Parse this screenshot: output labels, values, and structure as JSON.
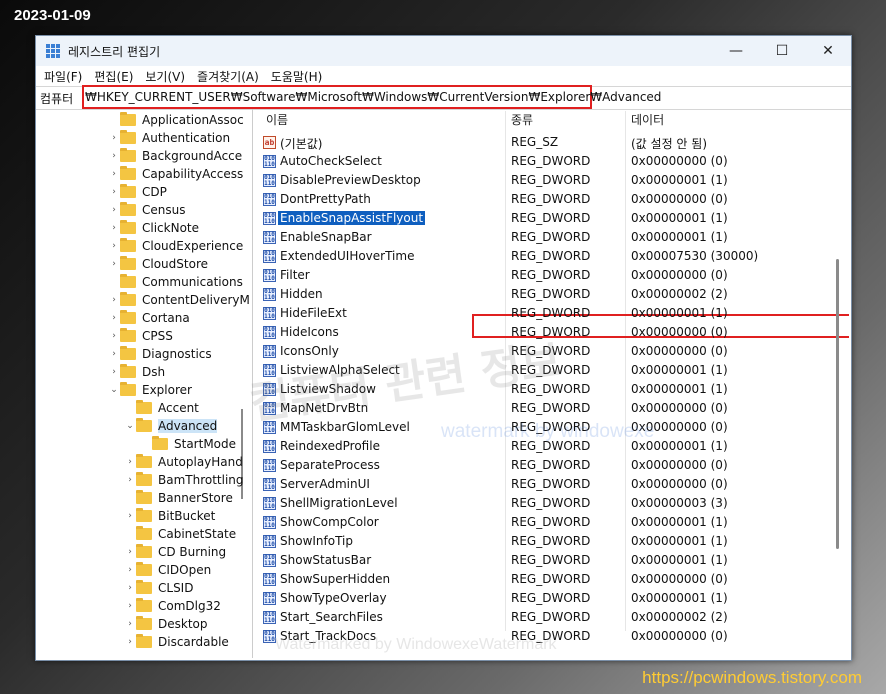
{
  "overlay": {
    "date": "2023-01-09",
    "blog_url": "https://pcwindows.tistory.com",
    "watermark_1": "컴퓨터 관련 정보",
    "watermark_2": "watermark by windowexe",
    "watermark_3": "Watermarked by WindowexeWatermark"
  },
  "window": {
    "title": "레지스트리 편집기",
    "minimize": "—",
    "maximize": "☐",
    "close": "✕"
  },
  "menu": [
    "파일(F)",
    "편집(E)",
    "보기(V)",
    "즐겨찾기(A)",
    "도움말(H)"
  ],
  "address": {
    "label": "컴퓨터",
    "path": "₩HKEY_CURRENT_USER₩Software₩Microsoft₩Windows₩CurrentVersion₩Explorer₩Advanced"
  },
  "tree": [
    {
      "label": "ApplicationAssoc",
      "level": 0,
      "chev": "",
      "selected": false
    },
    {
      "label": "Authentication",
      "level": 0,
      "chev": ">",
      "selected": false
    },
    {
      "label": "BackgroundAcce",
      "level": 0,
      "chev": ">",
      "selected": false
    },
    {
      "label": "CapabilityAccess",
      "level": 0,
      "chev": ">",
      "selected": false
    },
    {
      "label": "CDP",
      "level": 0,
      "chev": ">",
      "selected": false
    },
    {
      "label": "Census",
      "level": 0,
      "chev": ">",
      "selected": false
    },
    {
      "label": "ClickNote",
      "level": 0,
      "chev": ">",
      "selected": false
    },
    {
      "label": "CloudExperience",
      "level": 0,
      "chev": ">",
      "selected": false
    },
    {
      "label": "CloudStore",
      "level": 0,
      "chev": ">",
      "selected": false
    },
    {
      "label": "Communications",
      "level": 0,
      "chev": "",
      "selected": false
    },
    {
      "label": "ContentDeliveryM",
      "level": 0,
      "chev": ">",
      "selected": false
    },
    {
      "label": "Cortana",
      "level": 0,
      "chev": ">",
      "selected": false
    },
    {
      "label": "CPSS",
      "level": 0,
      "chev": ">",
      "selected": false
    },
    {
      "label": "Diagnostics",
      "level": 0,
      "chev": ">",
      "selected": false
    },
    {
      "label": "Dsh",
      "level": 0,
      "chev": ">",
      "selected": false
    },
    {
      "label": "Explorer",
      "level": 0,
      "chev": "v",
      "selected": false
    },
    {
      "label": "Accent",
      "level": 1,
      "chev": "",
      "selected": false
    },
    {
      "label": "Advanced",
      "level": 1,
      "chev": "v",
      "selected": true
    },
    {
      "label": "StartMode",
      "level": 2,
      "chev": "",
      "selected": false
    },
    {
      "label": "AutoplayHand",
      "level": 1,
      "chev": ">",
      "selected": false
    },
    {
      "label": "BamThrottling",
      "level": 1,
      "chev": ">",
      "selected": false
    },
    {
      "label": "BannerStore",
      "level": 1,
      "chev": "",
      "selected": false
    },
    {
      "label": "BitBucket",
      "level": 1,
      "chev": ">",
      "selected": false
    },
    {
      "label": "CabinetState",
      "level": 1,
      "chev": "",
      "selected": false
    },
    {
      "label": "CD Burning",
      "level": 1,
      "chev": ">",
      "selected": false
    },
    {
      "label": "CIDOpen",
      "level": 1,
      "chev": ">",
      "selected": false
    },
    {
      "label": "CLSID",
      "level": 1,
      "chev": ">",
      "selected": false
    },
    {
      "label": "ComDlg32",
      "level": 1,
      "chev": ">",
      "selected": false
    },
    {
      "label": "Desktop",
      "level": 1,
      "chev": ">",
      "selected": false
    },
    {
      "label": "Discardable",
      "level": 1,
      "chev": ">",
      "selected": false
    }
  ],
  "columns": {
    "name": "이름",
    "type": "종류",
    "data": "데이터"
  },
  "values": [
    {
      "name": "(기본값)",
      "type": "REG_SZ",
      "data": "(값 설정 안 됨)",
      "icon": "ab"
    },
    {
      "name": "AutoCheckSelect",
      "type": "REG_DWORD",
      "data": "0x00000000 (0)",
      "icon": "bin"
    },
    {
      "name": "DisablePreviewDesktop",
      "type": "REG_DWORD",
      "data": "0x00000001 (1)",
      "icon": "bin"
    },
    {
      "name": "DontPrettyPath",
      "type": "REG_DWORD",
      "data": "0x00000000 (0)",
      "icon": "bin"
    },
    {
      "name": "EnableSnapAssistFlyout",
      "type": "REG_DWORD",
      "data": "0x00000001 (1)",
      "icon": "bin",
      "selected": true
    },
    {
      "name": "EnableSnapBar",
      "type": "REG_DWORD",
      "data": "0x00000001 (1)",
      "icon": "bin"
    },
    {
      "name": "ExtendedUIHoverTime",
      "type": "REG_DWORD",
      "data": "0x00007530 (30000)",
      "icon": "bin"
    },
    {
      "name": "Filter",
      "type": "REG_DWORD",
      "data": "0x00000000 (0)",
      "icon": "bin"
    },
    {
      "name": "Hidden",
      "type": "REG_DWORD",
      "data": "0x00000002 (2)",
      "icon": "bin"
    },
    {
      "name": "HideFileExt",
      "type": "REG_DWORD",
      "data": "0x00000001 (1)",
      "icon": "bin"
    },
    {
      "name": "HideIcons",
      "type": "REG_DWORD",
      "data": "0x00000000 (0)",
      "icon": "bin"
    },
    {
      "name": "IconsOnly",
      "type": "REG_DWORD",
      "data": "0x00000000 (0)",
      "icon": "bin"
    },
    {
      "name": "ListviewAlphaSelect",
      "type": "REG_DWORD",
      "data": "0x00000001 (1)",
      "icon": "bin"
    },
    {
      "name": "ListviewShadow",
      "type": "REG_DWORD",
      "data": "0x00000001 (1)",
      "icon": "bin"
    },
    {
      "name": "MapNetDrvBtn",
      "type": "REG_DWORD",
      "data": "0x00000000 (0)",
      "icon": "bin"
    },
    {
      "name": "MMTaskbarGlomLevel",
      "type": "REG_DWORD",
      "data": "0x00000000 (0)",
      "icon": "bin"
    },
    {
      "name": "ReindexedProfile",
      "type": "REG_DWORD",
      "data": "0x00000001 (1)",
      "icon": "bin"
    },
    {
      "name": "SeparateProcess",
      "type": "REG_DWORD",
      "data": "0x00000000 (0)",
      "icon": "bin"
    },
    {
      "name": "ServerAdminUI",
      "type": "REG_DWORD",
      "data": "0x00000000 (0)",
      "icon": "bin"
    },
    {
      "name": "ShellMigrationLevel",
      "type": "REG_DWORD",
      "data": "0x00000003 (3)",
      "icon": "bin"
    },
    {
      "name": "ShowCompColor",
      "type": "REG_DWORD",
      "data": "0x00000001 (1)",
      "icon": "bin"
    },
    {
      "name": "ShowInfoTip",
      "type": "REG_DWORD",
      "data": "0x00000001 (1)",
      "icon": "bin"
    },
    {
      "name": "ShowStatusBar",
      "type": "REG_DWORD",
      "data": "0x00000001 (1)",
      "icon": "bin"
    },
    {
      "name": "ShowSuperHidden",
      "type": "REG_DWORD",
      "data": "0x00000000 (0)",
      "icon": "bin"
    },
    {
      "name": "ShowTypeOverlay",
      "type": "REG_DWORD",
      "data": "0x00000001 (1)",
      "icon": "bin"
    },
    {
      "name": "Start_SearchFiles",
      "type": "REG_DWORD",
      "data": "0x00000002 (2)",
      "icon": "bin"
    },
    {
      "name": "Start_TrackDocs",
      "type": "REG_DWORD",
      "data": "0x00000000 (0)",
      "icon": "bin"
    }
  ],
  "colors": {
    "selection": "#0f5fbf",
    "highlight_box": "#e02020",
    "folder": "#f4c542",
    "blog_url": "#ffcc33"
  }
}
